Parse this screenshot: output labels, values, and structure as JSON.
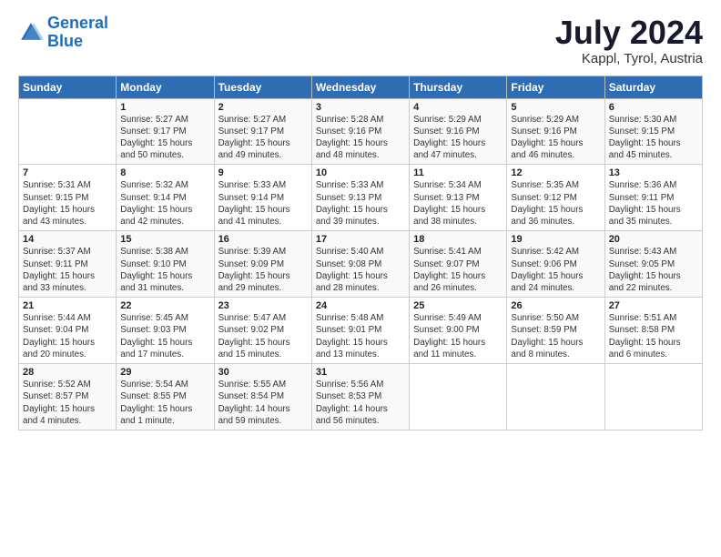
{
  "header": {
    "logo_line1": "General",
    "logo_line2": "Blue",
    "title": "July 2024",
    "subtitle": "Kappl, Tyrol, Austria"
  },
  "columns": [
    "Sunday",
    "Monday",
    "Tuesday",
    "Wednesday",
    "Thursday",
    "Friday",
    "Saturday"
  ],
  "weeks": [
    [
      {
        "day": "",
        "info": ""
      },
      {
        "day": "1",
        "info": "Sunrise: 5:27 AM\nSunset: 9:17 PM\nDaylight: 15 hours\nand 50 minutes."
      },
      {
        "day": "2",
        "info": "Sunrise: 5:27 AM\nSunset: 9:17 PM\nDaylight: 15 hours\nand 49 minutes."
      },
      {
        "day": "3",
        "info": "Sunrise: 5:28 AM\nSunset: 9:16 PM\nDaylight: 15 hours\nand 48 minutes."
      },
      {
        "day": "4",
        "info": "Sunrise: 5:29 AM\nSunset: 9:16 PM\nDaylight: 15 hours\nand 47 minutes."
      },
      {
        "day": "5",
        "info": "Sunrise: 5:29 AM\nSunset: 9:16 PM\nDaylight: 15 hours\nand 46 minutes."
      },
      {
        "day": "6",
        "info": "Sunrise: 5:30 AM\nSunset: 9:15 PM\nDaylight: 15 hours\nand 45 minutes."
      }
    ],
    [
      {
        "day": "7",
        "info": "Sunrise: 5:31 AM\nSunset: 9:15 PM\nDaylight: 15 hours\nand 43 minutes."
      },
      {
        "day": "8",
        "info": "Sunrise: 5:32 AM\nSunset: 9:14 PM\nDaylight: 15 hours\nand 42 minutes."
      },
      {
        "day": "9",
        "info": "Sunrise: 5:33 AM\nSunset: 9:14 PM\nDaylight: 15 hours\nand 41 minutes."
      },
      {
        "day": "10",
        "info": "Sunrise: 5:33 AM\nSunset: 9:13 PM\nDaylight: 15 hours\nand 39 minutes."
      },
      {
        "day": "11",
        "info": "Sunrise: 5:34 AM\nSunset: 9:13 PM\nDaylight: 15 hours\nand 38 minutes."
      },
      {
        "day": "12",
        "info": "Sunrise: 5:35 AM\nSunset: 9:12 PM\nDaylight: 15 hours\nand 36 minutes."
      },
      {
        "day": "13",
        "info": "Sunrise: 5:36 AM\nSunset: 9:11 PM\nDaylight: 15 hours\nand 35 minutes."
      }
    ],
    [
      {
        "day": "14",
        "info": "Sunrise: 5:37 AM\nSunset: 9:11 PM\nDaylight: 15 hours\nand 33 minutes."
      },
      {
        "day": "15",
        "info": "Sunrise: 5:38 AM\nSunset: 9:10 PM\nDaylight: 15 hours\nand 31 minutes."
      },
      {
        "day": "16",
        "info": "Sunrise: 5:39 AM\nSunset: 9:09 PM\nDaylight: 15 hours\nand 29 minutes."
      },
      {
        "day": "17",
        "info": "Sunrise: 5:40 AM\nSunset: 9:08 PM\nDaylight: 15 hours\nand 28 minutes."
      },
      {
        "day": "18",
        "info": "Sunrise: 5:41 AM\nSunset: 9:07 PM\nDaylight: 15 hours\nand 26 minutes."
      },
      {
        "day": "19",
        "info": "Sunrise: 5:42 AM\nSunset: 9:06 PM\nDaylight: 15 hours\nand 24 minutes."
      },
      {
        "day": "20",
        "info": "Sunrise: 5:43 AM\nSunset: 9:05 PM\nDaylight: 15 hours\nand 22 minutes."
      }
    ],
    [
      {
        "day": "21",
        "info": "Sunrise: 5:44 AM\nSunset: 9:04 PM\nDaylight: 15 hours\nand 20 minutes."
      },
      {
        "day": "22",
        "info": "Sunrise: 5:45 AM\nSunset: 9:03 PM\nDaylight: 15 hours\nand 17 minutes."
      },
      {
        "day": "23",
        "info": "Sunrise: 5:47 AM\nSunset: 9:02 PM\nDaylight: 15 hours\nand 15 minutes."
      },
      {
        "day": "24",
        "info": "Sunrise: 5:48 AM\nSunset: 9:01 PM\nDaylight: 15 hours\nand 13 minutes."
      },
      {
        "day": "25",
        "info": "Sunrise: 5:49 AM\nSunset: 9:00 PM\nDaylight: 15 hours\nand 11 minutes."
      },
      {
        "day": "26",
        "info": "Sunrise: 5:50 AM\nSunset: 8:59 PM\nDaylight: 15 hours\nand 8 minutes."
      },
      {
        "day": "27",
        "info": "Sunrise: 5:51 AM\nSunset: 8:58 PM\nDaylight: 15 hours\nand 6 minutes."
      }
    ],
    [
      {
        "day": "28",
        "info": "Sunrise: 5:52 AM\nSunset: 8:57 PM\nDaylight: 15 hours\nand 4 minutes."
      },
      {
        "day": "29",
        "info": "Sunrise: 5:54 AM\nSunset: 8:55 PM\nDaylight: 15 hours\nand 1 minute."
      },
      {
        "day": "30",
        "info": "Sunrise: 5:55 AM\nSunset: 8:54 PM\nDaylight: 14 hours\nand 59 minutes."
      },
      {
        "day": "31",
        "info": "Sunrise: 5:56 AM\nSunset: 8:53 PM\nDaylight: 14 hours\nand 56 minutes."
      },
      {
        "day": "",
        "info": ""
      },
      {
        "day": "",
        "info": ""
      },
      {
        "day": "",
        "info": ""
      }
    ]
  ]
}
